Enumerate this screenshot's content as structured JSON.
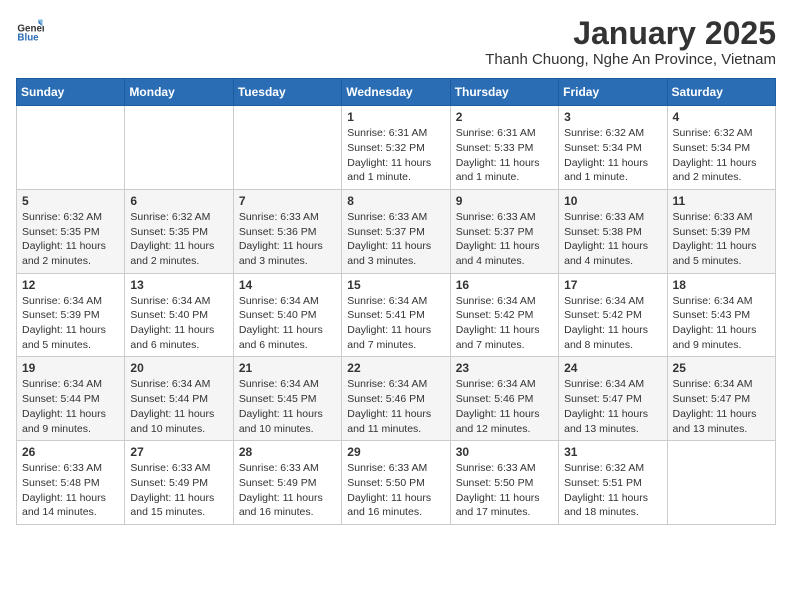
{
  "header": {
    "logo_general": "General",
    "logo_blue": "Blue",
    "title": "January 2025",
    "subtitle": "Thanh Chuong, Nghe An Province, Vietnam"
  },
  "calendar": {
    "weekdays": [
      "Sunday",
      "Monday",
      "Tuesday",
      "Wednesday",
      "Thursday",
      "Friday",
      "Saturday"
    ],
    "weeks": [
      [
        {
          "day": "",
          "info": ""
        },
        {
          "day": "",
          "info": ""
        },
        {
          "day": "",
          "info": ""
        },
        {
          "day": "1",
          "info": "Sunrise: 6:31 AM\nSunset: 5:32 PM\nDaylight: 11 hours\nand 1 minute."
        },
        {
          "day": "2",
          "info": "Sunrise: 6:31 AM\nSunset: 5:33 PM\nDaylight: 11 hours\nand 1 minute."
        },
        {
          "day": "3",
          "info": "Sunrise: 6:32 AM\nSunset: 5:34 PM\nDaylight: 11 hours\nand 1 minute."
        },
        {
          "day": "4",
          "info": "Sunrise: 6:32 AM\nSunset: 5:34 PM\nDaylight: 11 hours\nand 2 minutes."
        }
      ],
      [
        {
          "day": "5",
          "info": "Sunrise: 6:32 AM\nSunset: 5:35 PM\nDaylight: 11 hours\nand 2 minutes."
        },
        {
          "day": "6",
          "info": "Sunrise: 6:32 AM\nSunset: 5:35 PM\nDaylight: 11 hours\nand 2 minutes."
        },
        {
          "day": "7",
          "info": "Sunrise: 6:33 AM\nSunset: 5:36 PM\nDaylight: 11 hours\nand 3 minutes."
        },
        {
          "day": "8",
          "info": "Sunrise: 6:33 AM\nSunset: 5:37 PM\nDaylight: 11 hours\nand 3 minutes."
        },
        {
          "day": "9",
          "info": "Sunrise: 6:33 AM\nSunset: 5:37 PM\nDaylight: 11 hours\nand 4 minutes."
        },
        {
          "day": "10",
          "info": "Sunrise: 6:33 AM\nSunset: 5:38 PM\nDaylight: 11 hours\nand 4 minutes."
        },
        {
          "day": "11",
          "info": "Sunrise: 6:33 AM\nSunset: 5:39 PM\nDaylight: 11 hours\nand 5 minutes."
        }
      ],
      [
        {
          "day": "12",
          "info": "Sunrise: 6:34 AM\nSunset: 5:39 PM\nDaylight: 11 hours\nand 5 minutes."
        },
        {
          "day": "13",
          "info": "Sunrise: 6:34 AM\nSunset: 5:40 PM\nDaylight: 11 hours\nand 6 minutes."
        },
        {
          "day": "14",
          "info": "Sunrise: 6:34 AM\nSunset: 5:40 PM\nDaylight: 11 hours\nand 6 minutes."
        },
        {
          "day": "15",
          "info": "Sunrise: 6:34 AM\nSunset: 5:41 PM\nDaylight: 11 hours\nand 7 minutes."
        },
        {
          "day": "16",
          "info": "Sunrise: 6:34 AM\nSunset: 5:42 PM\nDaylight: 11 hours\nand 7 minutes."
        },
        {
          "day": "17",
          "info": "Sunrise: 6:34 AM\nSunset: 5:42 PM\nDaylight: 11 hours\nand 8 minutes."
        },
        {
          "day": "18",
          "info": "Sunrise: 6:34 AM\nSunset: 5:43 PM\nDaylight: 11 hours\nand 9 minutes."
        }
      ],
      [
        {
          "day": "19",
          "info": "Sunrise: 6:34 AM\nSunset: 5:44 PM\nDaylight: 11 hours\nand 9 minutes."
        },
        {
          "day": "20",
          "info": "Sunrise: 6:34 AM\nSunset: 5:44 PM\nDaylight: 11 hours\nand 10 minutes."
        },
        {
          "day": "21",
          "info": "Sunrise: 6:34 AM\nSunset: 5:45 PM\nDaylight: 11 hours\nand 10 minutes."
        },
        {
          "day": "22",
          "info": "Sunrise: 6:34 AM\nSunset: 5:46 PM\nDaylight: 11 hours\nand 11 minutes."
        },
        {
          "day": "23",
          "info": "Sunrise: 6:34 AM\nSunset: 5:46 PM\nDaylight: 11 hours\nand 12 minutes."
        },
        {
          "day": "24",
          "info": "Sunrise: 6:34 AM\nSunset: 5:47 PM\nDaylight: 11 hours\nand 13 minutes."
        },
        {
          "day": "25",
          "info": "Sunrise: 6:34 AM\nSunset: 5:47 PM\nDaylight: 11 hours\nand 13 minutes."
        }
      ],
      [
        {
          "day": "26",
          "info": "Sunrise: 6:33 AM\nSunset: 5:48 PM\nDaylight: 11 hours\nand 14 minutes."
        },
        {
          "day": "27",
          "info": "Sunrise: 6:33 AM\nSunset: 5:49 PM\nDaylight: 11 hours\nand 15 minutes."
        },
        {
          "day": "28",
          "info": "Sunrise: 6:33 AM\nSunset: 5:49 PM\nDaylight: 11 hours\nand 16 minutes."
        },
        {
          "day": "29",
          "info": "Sunrise: 6:33 AM\nSunset: 5:50 PM\nDaylight: 11 hours\nand 16 minutes."
        },
        {
          "day": "30",
          "info": "Sunrise: 6:33 AM\nSunset: 5:50 PM\nDaylight: 11 hours\nand 17 minutes."
        },
        {
          "day": "31",
          "info": "Sunrise: 6:32 AM\nSunset: 5:51 PM\nDaylight: 11 hours\nand 18 minutes."
        },
        {
          "day": "",
          "info": ""
        }
      ]
    ]
  }
}
